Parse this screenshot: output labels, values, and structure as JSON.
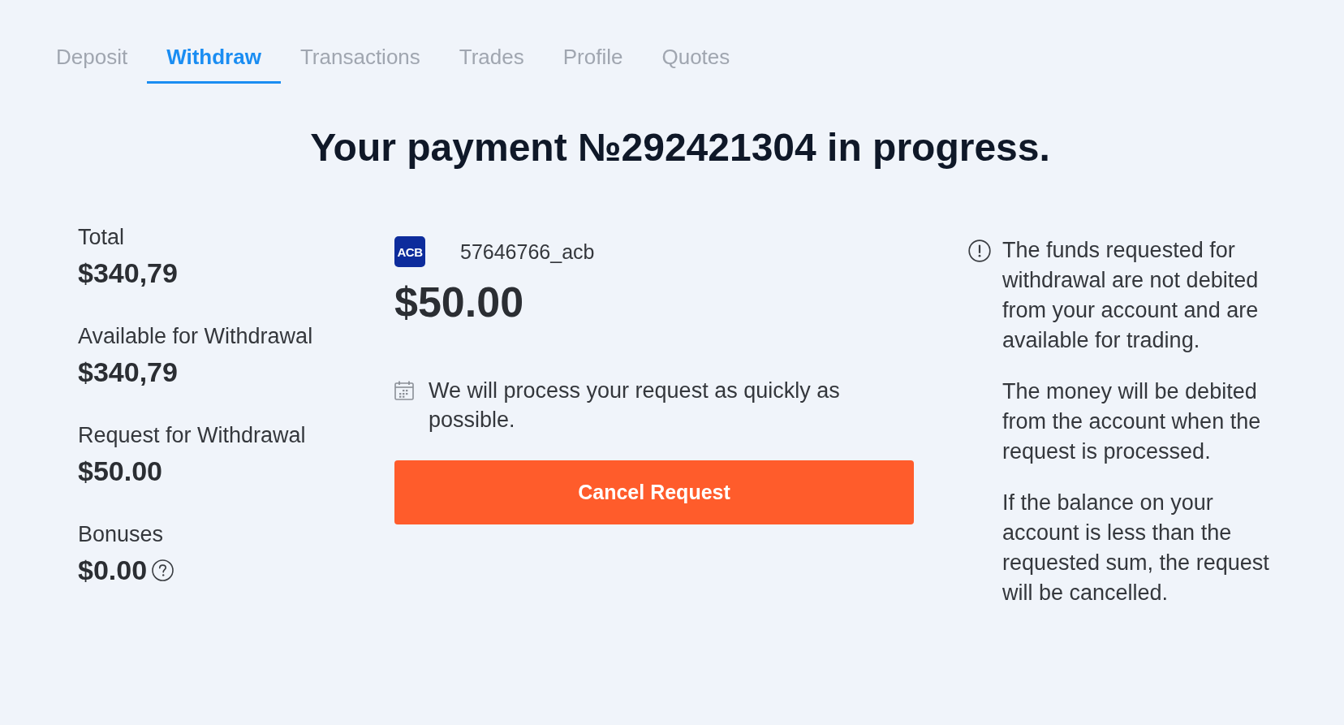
{
  "tabs": [
    {
      "label": "Deposit",
      "selected": false
    },
    {
      "label": "Withdraw",
      "selected": true
    },
    {
      "label": "Transactions",
      "selected": false
    },
    {
      "label": "Trades",
      "selected": false
    },
    {
      "label": "Profile",
      "selected": false
    },
    {
      "label": "Quotes",
      "selected": false
    }
  ],
  "title": "Your payment №292421304 in progress.",
  "summary": [
    {
      "kind": "amount",
      "label": "Total",
      "value": "$340,79"
    },
    {
      "kind": "amount",
      "label": "Available for Withdrawal",
      "value": "$340,79"
    },
    {
      "kind": "amount",
      "label": "Request for Withdrawal",
      "value": "$50.00"
    },
    {
      "kind": "amount_help",
      "label": "Bonuses",
      "value": "$0.00"
    }
  ],
  "payment": {
    "bank_logo": "ACB",
    "account": "57646766_acb",
    "amount": "$50.00",
    "note": "We will process your request as quickly as possible.",
    "cancel_button": "Cancel Request"
  },
  "notes": [
    "The funds requested for withdrawal are not debited from your account and are available for trading.",
    "The money will be debited from the account when the request is processed.",
    "If the balance on your account is less than the requested sum, the request will be cancelled."
  ]
}
